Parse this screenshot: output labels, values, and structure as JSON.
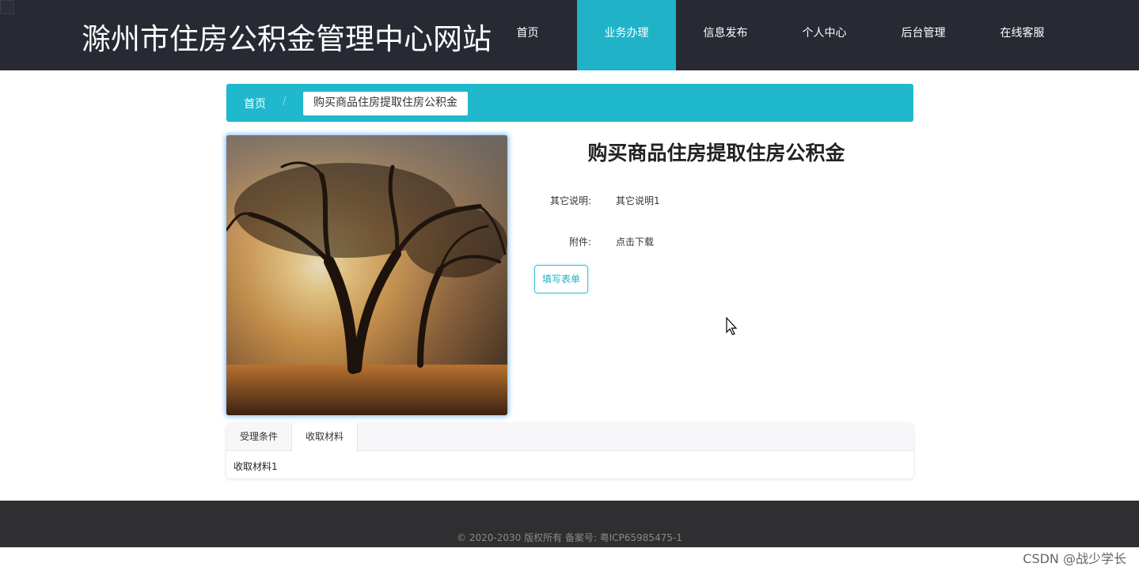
{
  "header": {
    "site_title": "滁州市住房公积金管理中心网站",
    "nav": [
      {
        "label": "首页",
        "active": false
      },
      {
        "label": "业务办理",
        "active": true
      },
      {
        "label": "信息发布",
        "active": false
      },
      {
        "label": "个人中心",
        "active": false
      },
      {
        "label": "后台管理",
        "active": false
      },
      {
        "label": "在线客服",
        "active": false
      }
    ]
  },
  "breadcrumb": {
    "home": "首页",
    "separator": "/",
    "current": "购买商品住房提取住房公积金"
  },
  "detail": {
    "title": "购买商品住房提取住房公积金",
    "note_label": "其它说明:",
    "note_value": "其它说明1",
    "attachment_label": "附件:",
    "attachment_link": "点击下载",
    "fill_form_button": "填写表单"
  },
  "tabs": {
    "items": [
      {
        "label": "受理条件",
        "active": false
      },
      {
        "label": "收取材料",
        "active": true
      }
    ],
    "content": "收取材料1"
  },
  "footer": {
    "copyright": "© 2020-2030 版权所有 备案号: 粤ICP65985475-1"
  },
  "watermark": "CSDN @战少学长",
  "colors": {
    "header_bg": "#272a33",
    "accent": "#1fb8cc",
    "footer_bg": "#2f2f31"
  }
}
